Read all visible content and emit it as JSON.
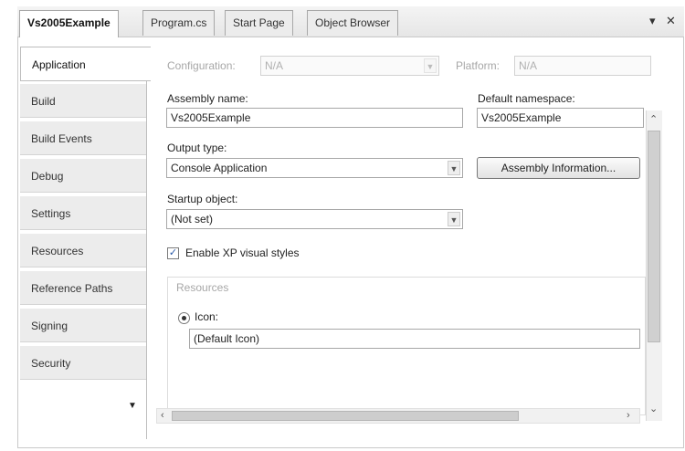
{
  "tabs": [
    {
      "label": "Vs2005Example",
      "active": true
    },
    {
      "label": "Program.cs",
      "active": false
    },
    {
      "label": "Start Page",
      "active": false
    },
    {
      "label": "Object Browser",
      "active": false
    }
  ],
  "window_controls": {
    "pin": "▾",
    "close": "✕"
  },
  "sidebar": {
    "items": [
      {
        "label": "Application"
      },
      {
        "label": "Build"
      },
      {
        "label": "Build Events"
      },
      {
        "label": "Debug"
      },
      {
        "label": "Settings"
      },
      {
        "label": "Resources"
      },
      {
        "label": "Reference Paths"
      },
      {
        "label": "Signing"
      },
      {
        "label": "Security"
      }
    ],
    "more_arrow": "▼"
  },
  "config": {
    "configuration_label": "Configuration:",
    "configuration_value": "N/A",
    "platform_label": "Platform:",
    "platform_value": "N/A"
  },
  "form": {
    "assembly_name_label": "Assembly name:",
    "assembly_name_value": "Vs2005Example",
    "default_namespace_label": "Default namespace:",
    "default_namespace_value": "Vs2005Example",
    "output_type_label": "Output type:",
    "output_type_value": "Console Application",
    "assembly_info_button": "Assembly Information...",
    "startup_object_label": "Startup object:",
    "startup_object_value": "(Not set)",
    "enable_xp_label": "Enable XP visual styles",
    "enable_xp_checked": true,
    "resources_group_label": "Resources",
    "icon_label": "Icon:",
    "icon_value": "(Default Icon)"
  },
  "scroll_glyphs": {
    "up": "⌃",
    "down": "⌄",
    "left": "‹",
    "right": "›"
  }
}
